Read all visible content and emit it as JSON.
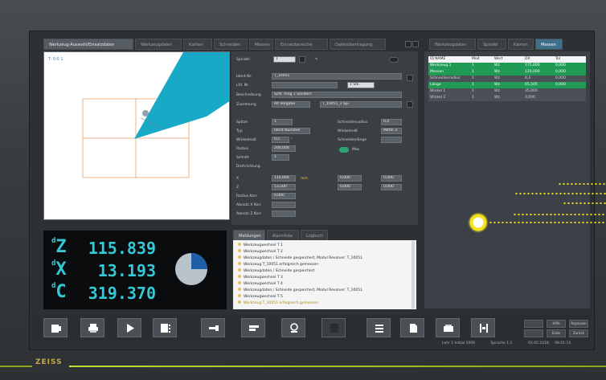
{
  "main_tabs": [
    "Werkzeug-Auswahl/Einsatzdaten",
    "Werkzeugdaten",
    "Kanten",
    "Schneiden",
    "Messen",
    "Einsatzbereiche",
    "Datenübertragung"
  ],
  "right_tabs": [
    "Werkzeugdaten",
    "Spindel",
    "Kanten",
    "Messen"
  ],
  "graphic": {
    "coord_label": "T: 0.0 1"
  },
  "form": {
    "row_labels": [
      "Spindel",
      "Ident-Nr.",
      "Lfd. Nr.",
      "Beschreibung",
      "Zuordnung",
      "Spitze",
      "Typ",
      "Winkelmaß",
      "Radius",
      "Schnitt",
      "Drehrichtung",
      "X",
      "Z",
      "Radius Korr.",
      "Abnutz X Korr.",
      "Abnutz Z Korr."
    ],
    "field_values": [
      "1",
      "T_10051",
      "",
      "Schl. Ring 1 Sondern ",
      "Alt Vorgabe",
      "1",
      "Ident-Nummer",
      "0,5",
      "200,000",
      "1",
      "110,000",
      "13,500",
      "0,000",
      "0,000",
      "0,000",
      "0,000",
      "0,000"
    ],
    "ident_suffix": "1 Stk.",
    "zuordnung_value": "T_10051_1 Spi",
    "side_labels": [
      "Schneidenradius",
      "Winkelmaß",
      "Schneidenlänge",
      "Werkzeugtyp"
    ],
    "side_values": [
      "0,4",
      "Mittel 3",
      "",
      ""
    ],
    "toggle_label": "Max",
    "unit_deg": "°",
    "unit_mm": "mm"
  },
  "right_table": {
    "headers": [
      "ID NAME",
      "Mod",
      "Wert",
      "DX",
      "Tol"
    ],
    "rows": [
      {
        "cells": [
          "Werkzeug 1",
          "1",
          "Wz",
          "175,000",
          "0,000"
        ],
        "style": "green"
      },
      {
        "cells": [
          "Messen",
          "1",
          "Wz",
          "120,000",
          "0,000"
        ],
        "style": "green"
      },
      {
        "cells": [
          "Schneidenradius",
          "1",
          "Wz",
          "0,4",
          "0,000"
        ],
        "style": "dark"
      },
      {
        "cells": [
          "Länge",
          "1",
          "Wz",
          "65,500",
          "0,000"
        ],
        "style": "green"
      },
      {
        "cells": [
          "Winkel 1",
          "1",
          "Wz",
          "35,000",
          ""
        ],
        "style": "dark"
      },
      {
        "cells": [
          "Winkel 2",
          "1",
          "Wz",
          "3,000",
          ""
        ],
        "style": "dark"
      }
    ]
  },
  "dro": {
    "axes": [
      {
        "name": "Z",
        "value": "115.839"
      },
      {
        "name": "X",
        "value": "13.193"
      },
      {
        "name": "C",
        "value": "319.370"
      }
    ],
    "pie_fraction": 0.25
  },
  "messages": {
    "tabs": [
      "Meldungen",
      "Alarmliste",
      "Logbuch"
    ],
    "items": [
      "Werkzeugwechsel T 1",
      "Werkzeugwechsel T 2",
      "Werkzeugdaten / Schneide gespeichert, Modul Revolver: T_10051",
      "Werkzeug T_10051 erfolgreich gemessen",
      "Werkzeugdaten / Schneide gespeichert",
      "Werkzeugwechsel T 3",
      "Werkzeugwechsel T 4",
      "Werkzeugdaten / Schneide gespeichert, Modul Revolver: T_10051",
      "Werkzeugwechsel T 5",
      "Werkzeug T_10051 erfolgreich gemessen"
    ]
  },
  "softkeys": [
    "Programm",
    "Drucken",
    "Start",
    "Liste",
    "Werkzeug",
    "Messen",
    "Einrichten",
    "Stopp",
    "Menü",
    "Seite",
    "Speicher",
    "Ausrichten"
  ],
  "small_keys": [
    "Anpassen",
    "Zurück",
    "Hilfe",
    "Ende"
  ],
  "status_bar": {
    "user": "Lehr 1 Initial 2009",
    "mode": "Sprache 1:1",
    "date": "03.05.2018",
    "time": "08:01:15"
  },
  "brand": "ZEISS",
  "accent_colors": {
    "cyan": "#35c9d8",
    "green": "#1f9b55",
    "yellow": "#f4e21c",
    "graphic_blue": "#18a9c7"
  }
}
